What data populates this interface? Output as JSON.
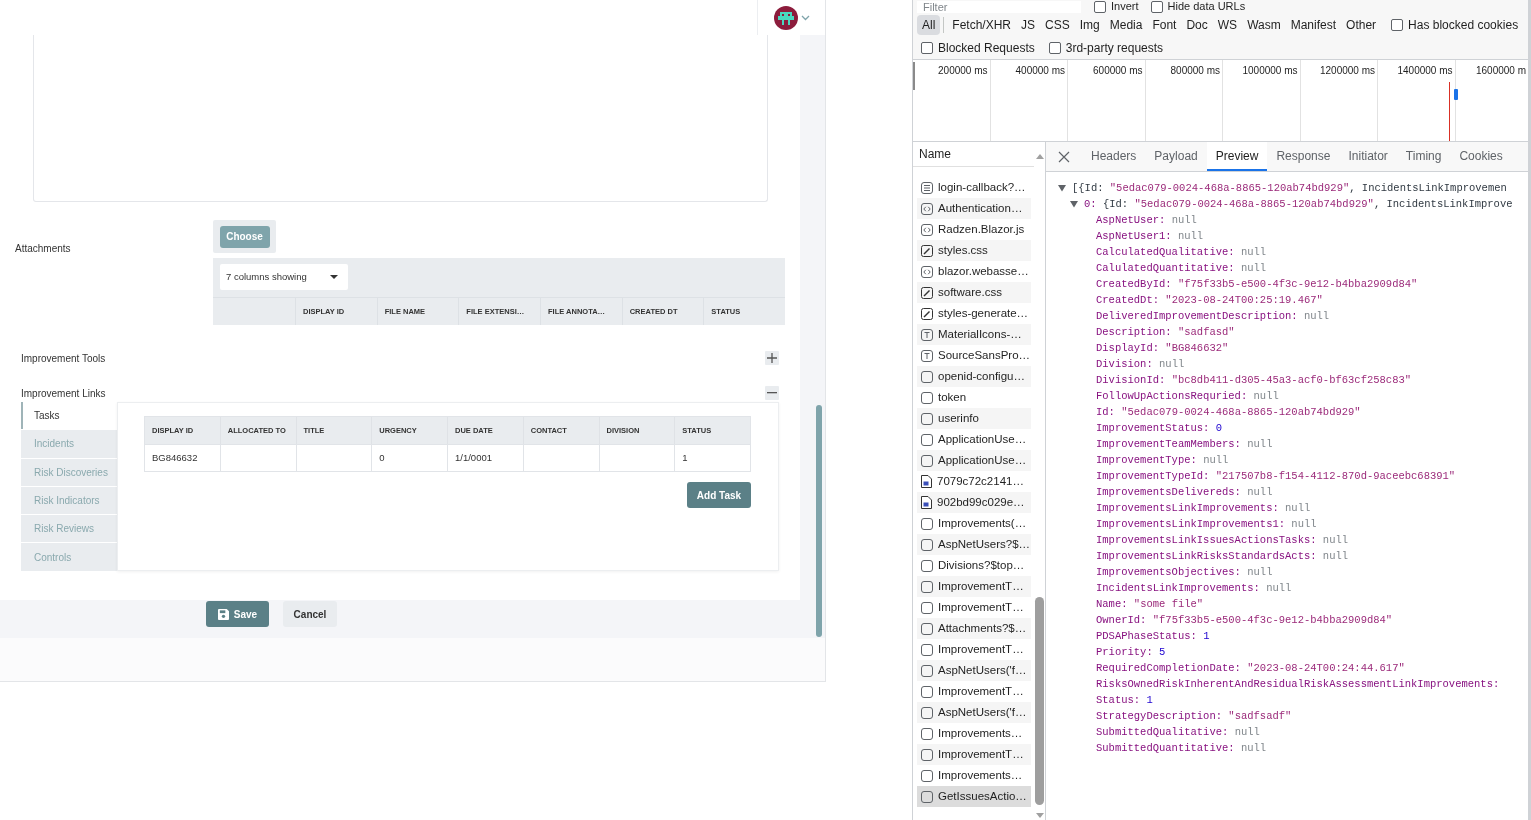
{
  "app": {
    "attachments": {
      "label": "Attachments",
      "choose_button": "Choose",
      "columns_dropdown": "7 columns showing",
      "columns": [
        "DISPLAY ID",
        "FILE NAME",
        "FILE EXTENSI…",
        "FILE ANNOTA…",
        "CREATED DT",
        "STATUS"
      ]
    },
    "sections": [
      {
        "label": "Improvement Tools",
        "expanded": false
      },
      {
        "label": "Improvement Links",
        "expanded": true,
        "tabs": [
          {
            "label": "Tasks",
            "selected": true
          },
          {
            "label": "Incidents",
            "selected": false
          },
          {
            "label": "Risk Discoveries",
            "selected": false
          },
          {
            "label": "Risk Indicators",
            "selected": false
          },
          {
            "label": "Risk Reviews",
            "selected": false
          },
          {
            "label": "Controls",
            "selected": false
          }
        ],
        "table": {
          "columns": [
            "DISPLAY ID",
            "ALLOCATED TO",
            "TITLE",
            "URGENCY",
            "DUE DATE",
            "CONTACT",
            "DIVISION",
            "STATUS"
          ],
          "rows": [
            [
              "BG846632",
              null,
              null,
              "0",
              "1/1/0001",
              null,
              null,
              "1"
            ]
          ]
        },
        "add_button": "Add Task"
      }
    ],
    "actions": [
      {
        "label": "Save",
        "kind": "primary"
      },
      {
        "label": "Cancel",
        "kind": "secondary"
      }
    ]
  },
  "devtools": {
    "filter": {
      "placeholder": "Filter"
    },
    "filter_options": [
      {
        "label": "Invert",
        "checked": false
      },
      {
        "label": "Hide data URLs",
        "checked": false
      }
    ],
    "type_filters": [
      {
        "label": "All",
        "selected": true
      },
      {
        "label": "Fetch/XHR",
        "selected": false
      },
      {
        "label": "JS",
        "selected": false
      },
      {
        "label": "CSS",
        "selected": false
      },
      {
        "label": "Img",
        "selected": false
      },
      {
        "label": "Media",
        "selected": false
      },
      {
        "label": "Font",
        "selected": false
      },
      {
        "label": "Doc",
        "selected": false
      },
      {
        "label": "WS",
        "selected": false
      },
      {
        "label": "Wasm",
        "selected": false
      },
      {
        "label": "Manifest",
        "selected": false
      },
      {
        "label": "Other",
        "selected": false
      }
    ],
    "blocked_cookies": {
      "label": "Has blocked cookies",
      "checked": false
    },
    "request_options": [
      {
        "label": "Blocked Requests",
        "checked": false
      },
      {
        "label": "3rd-party requests",
        "checked": false
      }
    ],
    "overview": {
      "ticks": [
        "200000 ms",
        "400000 ms",
        "600000 ms",
        "800000 ms",
        "1000000 ms",
        "1200000 ms",
        "1400000 ms",
        "1600000 m"
      ]
    },
    "requests": {
      "column": "Name",
      "rows": [
        {
          "name": "login-callback?…",
          "kind": "document",
          "selected": false
        },
        {
          "name": "Authentication…",
          "kind": "script",
          "selected": false
        },
        {
          "name": "Radzen.Blazor.js",
          "kind": "script",
          "selected": false
        },
        {
          "name": "styles.css",
          "kind": "stylesheet",
          "selected": false
        },
        {
          "name": "blazor.webasse…",
          "kind": "script",
          "selected": false
        },
        {
          "name": "software.css",
          "kind": "stylesheet",
          "selected": false
        },
        {
          "name": "styles-generate…",
          "kind": "stylesheet",
          "selected": false
        },
        {
          "name": "MaterialIcons-…",
          "kind": "font",
          "selected": false
        },
        {
          "name": "SourceSansPro…",
          "kind": "font",
          "selected": false
        },
        {
          "name": "openid-configu…",
          "kind": "fetch",
          "selected": false
        },
        {
          "name": "token",
          "kind": "fetch",
          "selected": false
        },
        {
          "name": "userinfo",
          "kind": "fetch",
          "selected": false
        },
        {
          "name": "ApplicationUse…",
          "kind": "fetch",
          "selected": false
        },
        {
          "name": "ApplicationUse…",
          "kind": "fetch",
          "selected": false
        },
        {
          "name": "7079c72c2141…",
          "kind": "image",
          "selected": false
        },
        {
          "name": "902bd99c029e…",
          "kind": "image",
          "selected": false
        },
        {
          "name": "Improvements(…",
          "kind": "fetch",
          "selected": false
        },
        {
          "name": "AspNetUsers?$…",
          "kind": "fetch",
          "selected": false
        },
        {
          "name": "Divisions?$top…",
          "kind": "fetch",
          "selected": false
        },
        {
          "name": "ImprovementT…",
          "kind": "fetch",
          "selected": false
        },
        {
          "name": "ImprovementT…",
          "kind": "fetch",
          "selected": false
        },
        {
          "name": "Attachments?$…",
          "kind": "fetch",
          "selected": false
        },
        {
          "name": "ImprovementT…",
          "kind": "fetch",
          "selected": false
        },
        {
          "name": "AspNetUsers('f…",
          "kind": "fetch",
          "selected": false
        },
        {
          "name": "ImprovementT…",
          "kind": "fetch",
          "selected": false
        },
        {
          "name": "AspNetUsers('f…",
          "kind": "fetch",
          "selected": false
        },
        {
          "name": "Improvements…",
          "kind": "fetch",
          "selected": false
        },
        {
          "name": "ImprovementT…",
          "kind": "fetch",
          "selected": false
        },
        {
          "name": "Improvements…",
          "kind": "fetch",
          "selected": false
        },
        {
          "name": "GetIssuesActio…",
          "kind": "fetch",
          "selected": true
        }
      ]
    },
    "detail_tabs": [
      {
        "label": "Headers",
        "selected": false
      },
      {
        "label": "Payload",
        "selected": false
      },
      {
        "label": "Preview",
        "selected": true
      },
      {
        "label": "Response",
        "selected": false
      },
      {
        "label": "Initiator",
        "selected": false
      },
      {
        "label": "Timing",
        "selected": false
      },
      {
        "label": "Cookies",
        "selected": false
      }
    ],
    "preview": {
      "tree": [
        {
          "expanded": true,
          "summary": [
            {
              "text": "[{Id: "
            },
            {
              "text": "\"5edac079-0024-468a-8865-120ab74bd929\"",
              "kind": "string"
            },
            {
              "text": ", IncidentsLinkImprovemen"
            }
          ],
          "children": [
            {
              "label": "0:",
              "expanded": true,
              "summary": [
                {
                  "text": "{Id: "
                },
                {
                  "text": "\"5edac079-0024-468a-8865-120ab74bd929\"",
                  "kind": "string"
                },
                {
                  "text": ", IncidentsLinkImprove"
                }
              ],
              "children": [
                {
                  "key": "AspNetUser:",
                  "value": "null",
                  "kind": "null"
                },
                {
                  "key": "AspNetUser1:",
                  "value": "null",
                  "kind": "null"
                },
                {
                  "key": "CalculatedQualitative:",
                  "value": "null",
                  "kind": "null"
                },
                {
                  "key": "CalulatedQuantitative:",
                  "value": "null",
                  "kind": "null"
                },
                {
                  "key": "CreatedById:",
                  "value": "\"f75f33b5-e500-4f3c-9e12-b4bba2909d84\"",
                  "kind": "string"
                },
                {
                  "key": "CreatedDt:",
                  "value": "\"2023-08-24T00:25:19.467\"",
                  "kind": "string"
                },
                {
                  "key": "DeliveredImprovementDescription:",
                  "value": "null",
                  "kind": "null"
                },
                {
                  "key": "Description:",
                  "value": "\"sadfasd\"",
                  "kind": "string"
                },
                {
                  "key": "DisplayId:",
                  "value": "\"BG846632\"",
                  "kind": "string"
                },
                {
                  "key": "Division:",
                  "value": "null",
                  "kind": "null"
                },
                {
                  "key": "DivisionId:",
                  "value": "\"bc8db411-d305-45a3-acf0-bf63cf258c83\"",
                  "kind": "string"
                },
                {
                  "key": "FollowUpActionsRequried:",
                  "value": "null",
                  "kind": "null"
                },
                {
                  "key": "Id:",
                  "value": "\"5edac079-0024-468a-8865-120ab74bd929\"",
                  "kind": "string"
                },
                {
                  "key": "ImprovementStatus:",
                  "value": "0",
                  "kind": "number"
                },
                {
                  "key": "ImprovementTeamMembers:",
                  "value": "null",
                  "kind": "null"
                },
                {
                  "key": "ImprovementType:",
                  "value": "null",
                  "kind": "null"
                },
                {
                  "key": "ImprovementTypeId:",
                  "value": "\"217507b8-f154-4112-870d-9aceebc68391\"",
                  "kind": "string"
                },
                {
                  "key": "ImprovementsDelivereds:",
                  "value": "null",
                  "kind": "null"
                },
                {
                  "key": "ImprovementsLinkImprovements:",
                  "value": "null",
                  "kind": "null"
                },
                {
                  "key": "ImprovementsLinkImprovements1:",
                  "value": "null",
                  "kind": "null"
                },
                {
                  "key": "ImprovementsLinkIssuesActionsTasks:",
                  "value": "null",
                  "kind": "null"
                },
                {
                  "key": "ImprovementsLinkRisksStandardsActs:",
                  "value": "null",
                  "kind": "null"
                },
                {
                  "key": "ImprovementsObjectives:",
                  "value": "null",
                  "kind": "null"
                },
                {
                  "key": "IncidentsLinkImprovements:",
                  "value": "null",
                  "kind": "null"
                },
                {
                  "key": "Name:",
                  "value": "\"some file\"",
                  "kind": "string"
                },
                {
                  "key": "OwnerId:",
                  "value": "\"f75f33b5-e500-4f3c-9e12-b4bba2909d84\"",
                  "kind": "string"
                },
                {
                  "key": "PDSAPhaseStatus:",
                  "value": "1",
                  "kind": "number"
                },
                {
                  "key": "Priority:",
                  "value": "5",
                  "kind": "number"
                },
                {
                  "key": "RequiredCompletionDate:",
                  "value": "\"2023-08-24T00:24:44.617\"",
                  "kind": "string"
                },
                {
                  "key": "RisksOwnedRiskInherentAndResidualRiskAssessmentLinkImprovements:"
                },
                {
                  "key": "Status:",
                  "value": "1",
                  "kind": "number"
                },
                {
                  "key": "StrategyDescription:",
                  "value": "\"sadfsadf\"",
                  "kind": "string"
                },
                {
                  "key": "SubmittedQualitative:",
                  "value": "null",
                  "kind": "null"
                },
                {
                  "key": "SubmittedQuantitative:",
                  "value": "null",
                  "kind": "null"
                }
              ]
            }
          ]
        }
      ]
    }
  }
}
